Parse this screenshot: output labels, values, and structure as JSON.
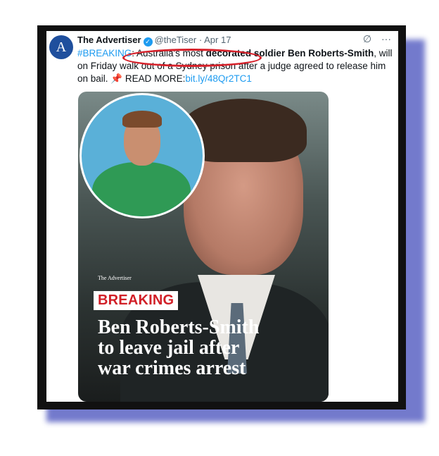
{
  "tweet": {
    "author_name": "The Advertiser",
    "avatar_letter": "A",
    "handle": "@theTiser",
    "separator": "·",
    "date": "Apr 17",
    "hashtag": "#BREAKING",
    "text_part1": ": Australia's most ",
    "text_bold1": "decorated soldier",
    "text_part2": " ",
    "text_bold2": "Ben Roberts-Smith",
    "text_part3": ", will on Friday walk out of a Sydney prison after a judge agreed to release him on bail. ",
    "pin_icon": "📌",
    "read_more": "READ MORE:",
    "link": "bit.ly/48Qr2TC1",
    "grok_icon": "∅",
    "more_icon": "···"
  },
  "media": {
    "brand": "The Advertiser",
    "label": "BREAKING",
    "headline_lines": [
      "Ben Roberts-Smith",
      "to leave jail after",
      "war crimes arrest"
    ]
  },
  "colors": {
    "accent": "#1d9bf0",
    "breaking_red": "#d11f27",
    "highlight_red": "#d6212a",
    "shadow_blue": "#5b63c4"
  }
}
